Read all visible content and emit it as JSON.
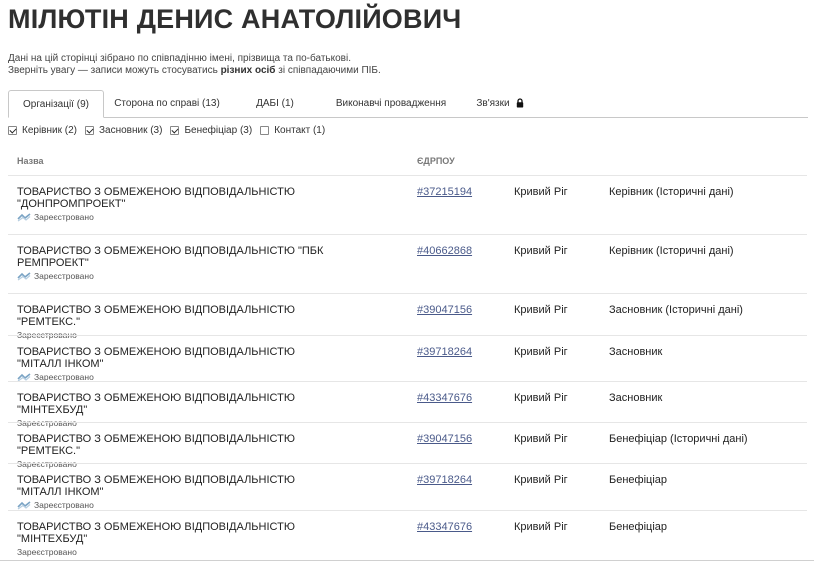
{
  "page": {
    "title": "МІЛЮТІН ДЕНИС АНАТОЛІЙОВИЧ",
    "notice_line1": "Дані на цій сторінці зібрано по співпадінню імені, прізвища та по-батькові.",
    "notice_line2_pre": "Зверніть увагу — записи можуть стосуватись ",
    "notice_line2_bold": "різних осіб",
    "notice_line2_post": " зі співпадаючими ПІБ."
  },
  "tabs": [
    {
      "label": "Організації (9)",
      "active": true
    },
    {
      "label": "Сторона по справі (13)",
      "active": false
    },
    {
      "label": "ДАБІ (1)",
      "active": false
    },
    {
      "label": "Виконавчі провадження",
      "active": false
    },
    {
      "label": "Зв'язки",
      "active": false,
      "icon": "lock-icon"
    }
  ],
  "filters": [
    {
      "label": "Керівник (2)",
      "checked": true
    },
    {
      "label": "Засновник (3)",
      "checked": true
    },
    {
      "label": "Бенефіціар (3)",
      "checked": true
    },
    {
      "label": "Контакт (1)",
      "checked": false
    }
  ],
  "table": {
    "headers": {
      "name": "Назва",
      "code": "ЄДРПОУ"
    },
    "rows": [
      {
        "name": "ТОВАРИСТВО З ОБМЕЖЕНОЮ ВІДПОВІДАЛЬНІСТЮ \"ДОНПРОМПРОЕКТ\"",
        "status": "Зареєстровано",
        "status_icon": true,
        "code": "#37215194",
        "city": "Кривий Ріг",
        "role": "Керівник (Історичні дані)"
      },
      {
        "name": "ТОВАРИСТВО З ОБМЕЖЕНОЮ ВІДПОВІДАЛЬНІСТЮ \"ПБК РЕМПРОЕКТ\"",
        "status": "Зареєстровано",
        "status_icon": true,
        "code": "#40662868",
        "city": "Кривий Ріг",
        "role": "Керівник (Історичні дані)"
      },
      {
        "name": "ТОВАРИСТВО З ОБМЕЖЕНОЮ ВІДПОВІДАЛЬНІСТЮ \"РЕМТЕКС.\"",
        "status": "Зареєстровано",
        "status_icon": false,
        "code": "#39047156",
        "city": "Кривий Ріг",
        "role": "Засновник (Історичні дані)"
      },
      {
        "name": "ТОВАРИСТВО З ОБМЕЖЕНОЮ ВІДПОВІДАЛЬНІСТЮ \"МІТАЛЛ ІНКОМ\"",
        "status": "Зареєстровано",
        "status_icon": true,
        "code": "#39718264",
        "city": "Кривий Ріг",
        "role": "Засновник"
      },
      {
        "name": "ТОВАРИСТВО З ОБМЕЖЕНОЮ ВІДПОВІДАЛЬНІСТЮ \"МІНТЕХБУД\"",
        "status": "Зареєстровано",
        "status_icon": false,
        "code": "#43347676",
        "city": "Кривий Ріг",
        "role": "Засновник"
      },
      {
        "name": "ТОВАРИСТВО З ОБМЕЖЕНОЮ ВІДПОВІДАЛЬНІСТЮ \"РЕМТЕКС.\"",
        "status": "Зареєстровано",
        "status_icon": false,
        "code": "#39047156",
        "city": "Кривий Ріг",
        "role": "Бенефіціар (Історичні дані)"
      },
      {
        "name": "ТОВАРИСТВО З ОБМЕЖЕНОЮ ВІДПОВІДАЛЬНІСТЮ \"МІТАЛЛ ІНКОМ\"",
        "status": "Зареєстровано",
        "status_icon": true,
        "code": "#39718264",
        "city": "Кривий Ріг",
        "role": "Бенефіціар"
      },
      {
        "name": "ТОВАРИСТВО З ОБМЕЖЕНОЮ ВІДПОВІДАЛЬНІСТЮ \"МІНТЕХБУД\"",
        "status": "Зареєстровано",
        "status_icon": false,
        "code": "#43347676",
        "city": "Кривий Ріг",
        "role": "Бенефіціар"
      }
    ]
  },
  "colors": {
    "link": "#4a5a8a",
    "title": "#2f2f2f",
    "border": "#c8c8c8"
  }
}
